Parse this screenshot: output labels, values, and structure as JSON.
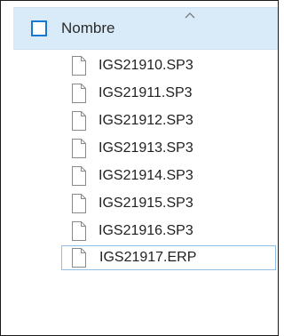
{
  "header": {
    "column_label": "Nombre",
    "checkbox_checked": false,
    "sort_direction": "ascending"
  },
  "files": [
    {
      "name": "IGS21910.SP3",
      "icon": "blank-file-icon",
      "selected": false
    },
    {
      "name": "IGS21911.SP3",
      "icon": "blank-file-icon",
      "selected": false
    },
    {
      "name": "IGS21912.SP3",
      "icon": "blank-file-icon",
      "selected": false
    },
    {
      "name": "IGS21913.SP3",
      "icon": "blank-file-icon",
      "selected": false
    },
    {
      "name": "IGS21914.SP3",
      "icon": "blank-file-icon",
      "selected": false
    },
    {
      "name": "IGS21915.SP3",
      "icon": "blank-file-icon",
      "selected": false
    },
    {
      "name": "IGS21916.SP3",
      "icon": "blank-file-icon",
      "selected": false
    },
    {
      "name": "IGS21917.ERP",
      "icon": "blank-file-icon",
      "selected": true
    }
  ],
  "colors": {
    "header_background": "#d9ebf9",
    "checkbox_border": "#1976d2",
    "selection_border": "#8fbfe8"
  }
}
